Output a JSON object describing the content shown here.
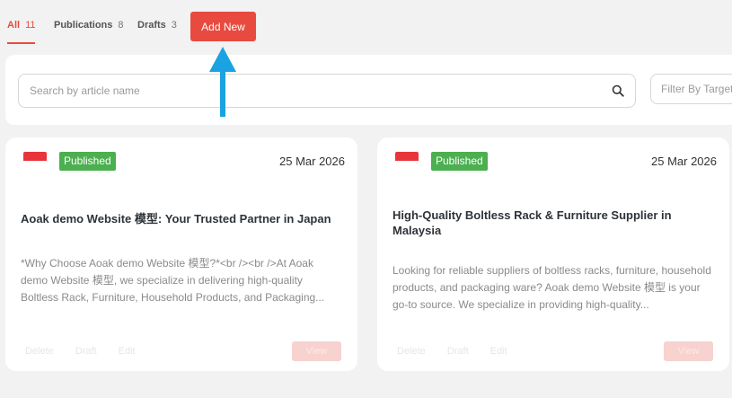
{
  "tabs": [
    {
      "label": "All",
      "count": "11"
    },
    {
      "label": "Publications",
      "count": "8"
    },
    {
      "label": "Drafts",
      "count": "3"
    }
  ],
  "add_button": "Add New",
  "search": {
    "placeholder": "Search by article name"
  },
  "filter": {
    "placeholder": "Filter By Target"
  },
  "cards": [
    {
      "status": "Published",
      "date": "25 Mar 2026",
      "title": "Aoak demo Website 模型: Your Trusted Partner in Japan",
      "description": "*Why Choose Aoak demo Website 模型?*<br /><br />At Aoak demo Website 模型, we specialize in delivering high-quality Boltless Rack, Furniture, Household Products, and Packaging...",
      "actions": [
        "Delete",
        "Draft",
        "Edit"
      ],
      "view": "View"
    },
    {
      "status": "Published",
      "date": "25 Mar 2026",
      "title": "High-Quality Boltless Rack & Furniture Supplier in Malaysia",
      "description": "Looking for reliable suppliers of boltless racks, furniture, household products, and packaging ware? Aoak demo Website 模型 is your go-to source. We specialize in providing high-quality...",
      "actions": [
        "Delete",
        "Draft",
        "Edit"
      ],
      "view": "View"
    }
  ],
  "colors": {
    "accent": "#e84a3f",
    "published": "#4caf50",
    "arrow": "#1aa3e0"
  }
}
